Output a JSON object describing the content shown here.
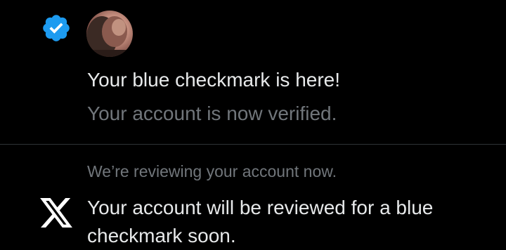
{
  "notifications": [
    {
      "icon": "verified-badge-icon",
      "avatar": "user-avatar",
      "title": "Your blue checkmark is here!",
      "subtitle": "Your account is now verified."
    },
    {
      "icon": "x-logo-icon",
      "preview": "We’re reviewing your account now.",
      "message": "Your account will be reviewed for a blue checkmark soon."
    }
  ],
  "colors": {
    "background": "#000000",
    "primary_text": "#e7e9ea",
    "secondary_text": "#71767b",
    "divider": "#2f3336",
    "verified_blue": "#1d9bf0"
  }
}
